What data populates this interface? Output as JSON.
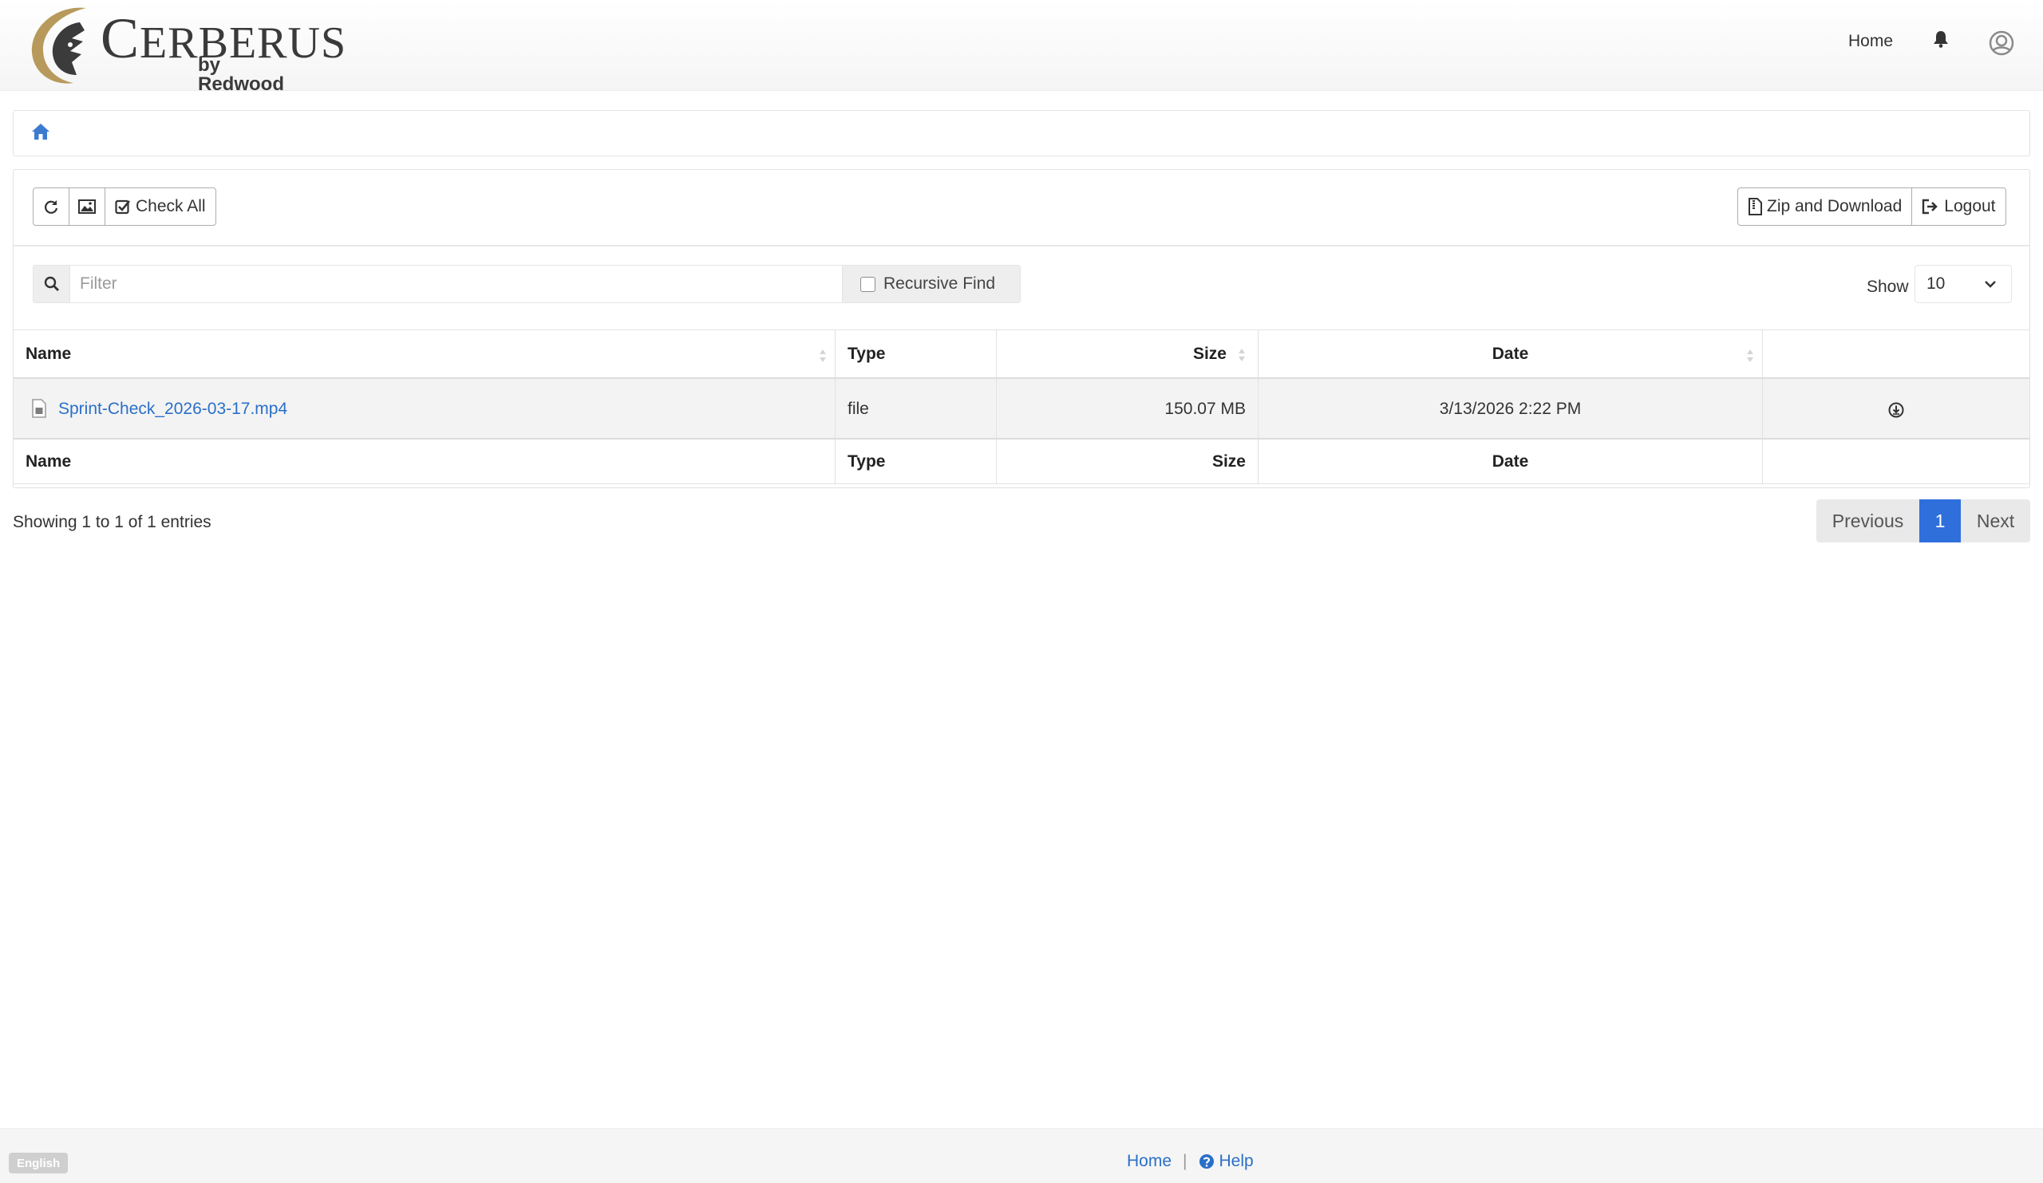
{
  "brand": {
    "name_cap": "C",
    "name_rest": "ERBERUS",
    "sub": "by Redwood"
  },
  "nav": {
    "home": "Home",
    "bell_icon": "bell-icon",
    "avatar_icon": "user-avatar-icon"
  },
  "breadcrumb": {
    "home_icon": "home-icon"
  },
  "toolbar": {
    "refresh_icon": "refresh-icon",
    "thumbnail_icon": "image-icon",
    "check_all": "Check All",
    "zip_download": "Zip and Download",
    "logout": "Logout"
  },
  "filter": {
    "placeholder": "Filter",
    "recursive": "Recursive Find",
    "show_label": "Show",
    "show_value": "10"
  },
  "table": {
    "headers": {
      "name": "Name",
      "type": "Type",
      "size": "Size",
      "date": "Date"
    },
    "rows": [
      {
        "name": "Sprint-Check_2026-03-17.mp4",
        "type": "file",
        "size": "150.07 MB",
        "date": "3/13/2026 2:22 PM"
      }
    ]
  },
  "paging": {
    "info": "Showing 1 to 1 of 1 entries",
    "previous": "Previous",
    "current": "1",
    "next": "Next"
  },
  "footer": {
    "language": "English",
    "home": "Home",
    "separator": "|",
    "help": "Help"
  },
  "colors": {
    "link": "#2a6fc9",
    "accent": "#2f6fdc",
    "logo_gold": "#b79a5b"
  }
}
